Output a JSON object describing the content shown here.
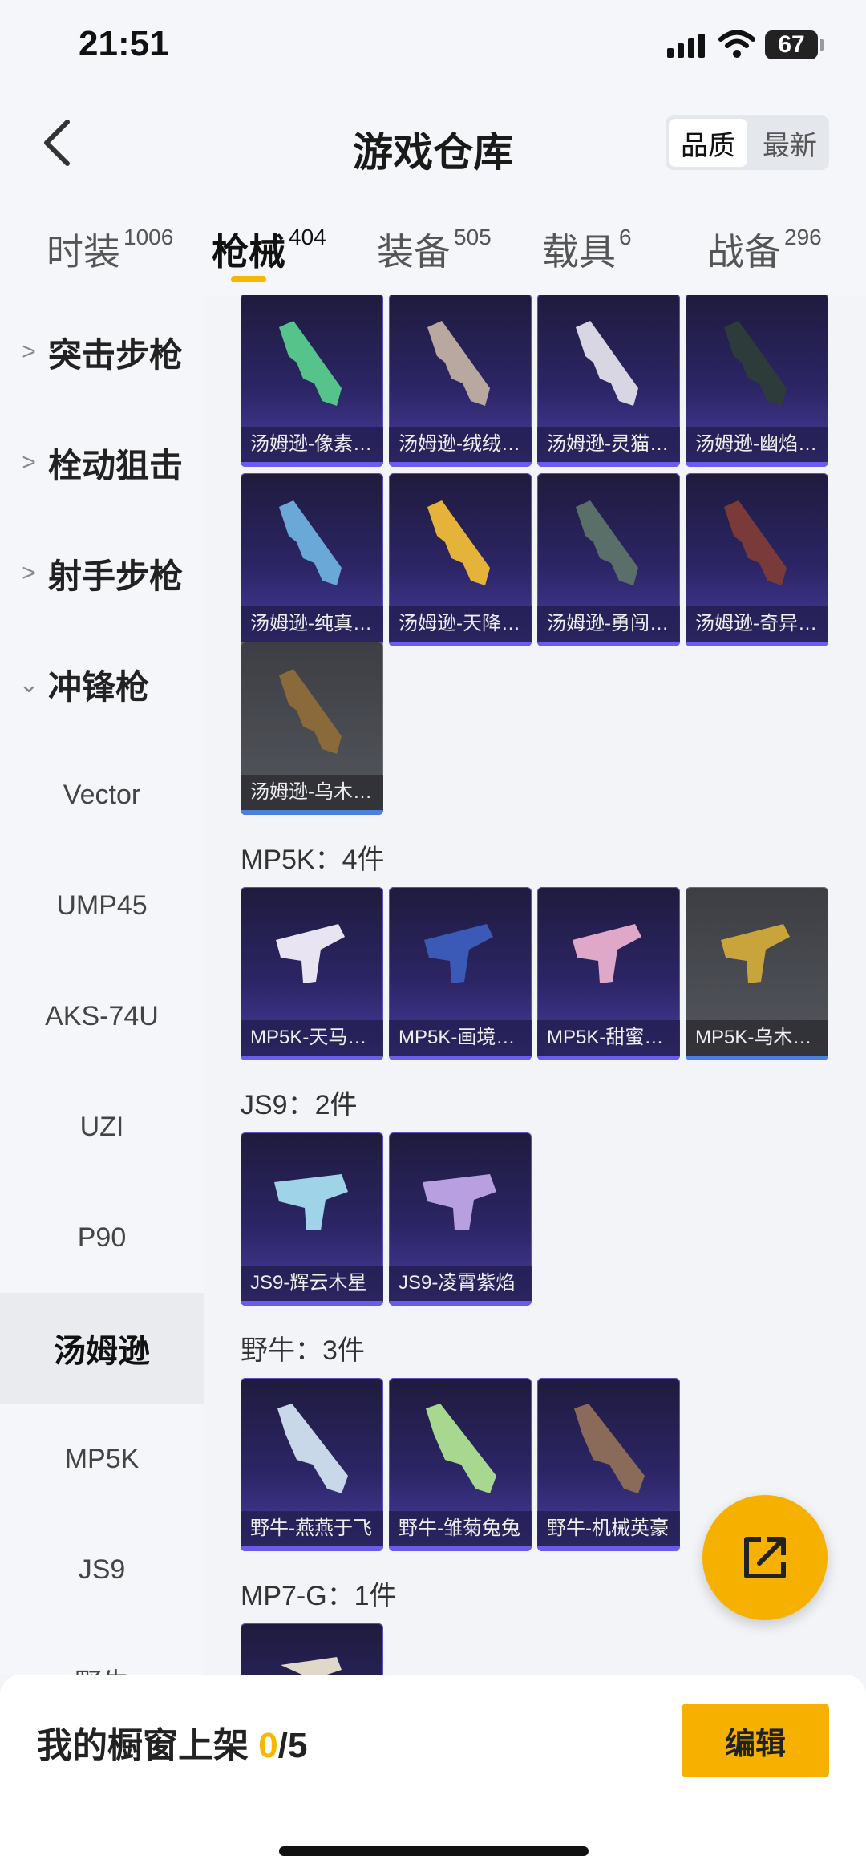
{
  "status_bar": {
    "time": "21:51",
    "battery": "67"
  },
  "header": {
    "title": "游戏仓库",
    "sort_options": [
      "品质",
      "最新"
    ]
  },
  "tabs": [
    {
      "label": "时装",
      "count": "1006"
    },
    {
      "label": "枪械",
      "count": "404"
    },
    {
      "label": "装备",
      "count": "505"
    },
    {
      "label": "载具",
      "count": "6"
    },
    {
      "label": "战备",
      "count": "296"
    }
  ],
  "sidebar": {
    "groups": [
      "突击步枪",
      "栓动狙击",
      "射手步枪",
      "冲锋枪"
    ],
    "items": [
      "Vector",
      "UMP45",
      "AKS-74U",
      "UZI",
      "P90",
      "汤姆逊",
      "MP5K",
      "JS9",
      "野牛"
    ]
  },
  "thompson_items": [
    "汤姆逊-像素…",
    "汤姆逊-绒绒…",
    "汤姆逊-灵猫…",
    "汤姆逊-幽焰…",
    "汤姆逊-纯真…",
    "汤姆逊-天降…",
    "汤姆逊-勇闯…",
    "汤姆逊-奇异…",
    "汤姆逊-乌木…"
  ],
  "sections": [
    {
      "title": "MP5K：4件",
      "items": [
        "MP5K-天马…",
        "MP5K-画境…",
        "MP5K-甜蜜…",
        "MP5K-乌木…"
      ]
    },
    {
      "title": "JS9：2件",
      "items": [
        "JS9-辉云木星",
        "JS9-凌霄紫焰"
      ]
    },
    {
      "title": "野牛：3件",
      "items": [
        "野牛-燕燕于飞",
        "野牛-雏菊兔兔",
        "野牛-机械英豪"
      ]
    },
    {
      "title": "MP7-G：1件",
      "items": [
        ""
      ]
    }
  ],
  "bottom": {
    "shelf_label": "我的橱窗上架 ",
    "shelf_count": "0",
    "shelf_total": "/5",
    "edit_label": "编辑"
  },
  "colors": {
    "accent": "#f6b100",
    "card_purple": "#2c2566",
    "card_grey": "#55575e"
  }
}
